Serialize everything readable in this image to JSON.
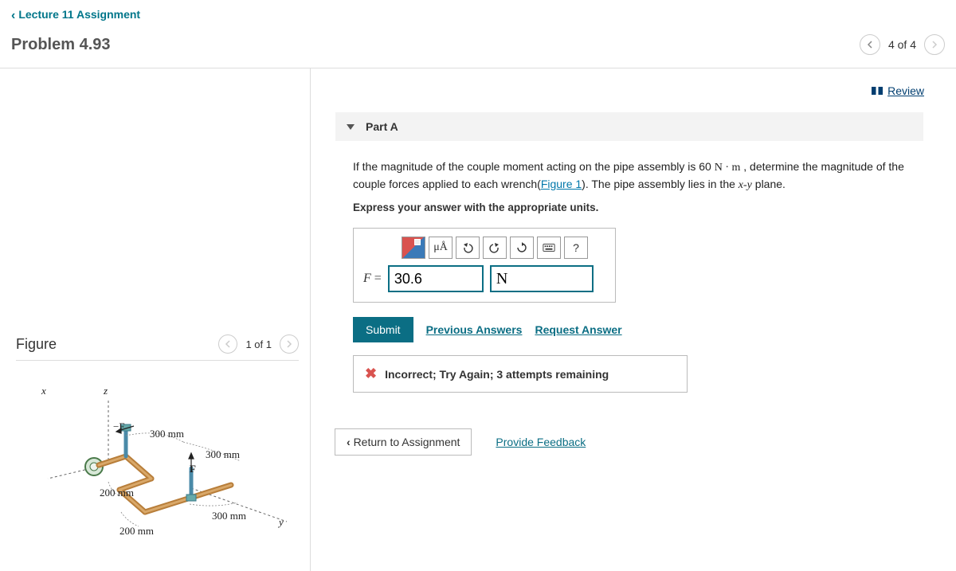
{
  "nav": {
    "back_label": "Lecture 11 Assignment",
    "problem_title": "Problem 4.93",
    "page_indicator": "4 of 4"
  },
  "review": {
    "label": "Review"
  },
  "figure": {
    "title": "Figure",
    "page_indicator": "1 of 1",
    "dims": {
      "d1": "300 mm",
      "d2": "300 mm",
      "d3": "200 mm",
      "d4": "200 mm",
      "d5": "300 mm"
    },
    "forces": {
      "neg": "−F",
      "pos": "F"
    },
    "axes": {
      "x": "x",
      "y": "y",
      "z": "z"
    }
  },
  "part": {
    "title": "Part A",
    "prompt_pre": "If the magnitude of the couple moment acting on the pipe assembly is 60 ",
    "prompt_unit": "N · m",
    "prompt_mid": " , determine the magnitude of the couple forces applied to each wrench(",
    "figure_link": "Figure 1",
    "prompt_post": "). The pipe assembly lies in the ",
    "plane_var": "x-y",
    "prompt_end": " plane.",
    "hint": "Express your answer with the appropriate units.",
    "toolbar": {
      "mu_label": "μÅ",
      "help_label": "?"
    },
    "eq_var": "F",
    "eq_op": "=",
    "value": "30.6",
    "unit": "N",
    "submit": "Submit",
    "prev_answers": "Previous Answers",
    "request_answer": "Request Answer",
    "feedback": "Incorrect; Try Again; 3 attempts remaining"
  },
  "bottom": {
    "return_label": "Return to Assignment",
    "feedback_label": "Provide Feedback"
  }
}
